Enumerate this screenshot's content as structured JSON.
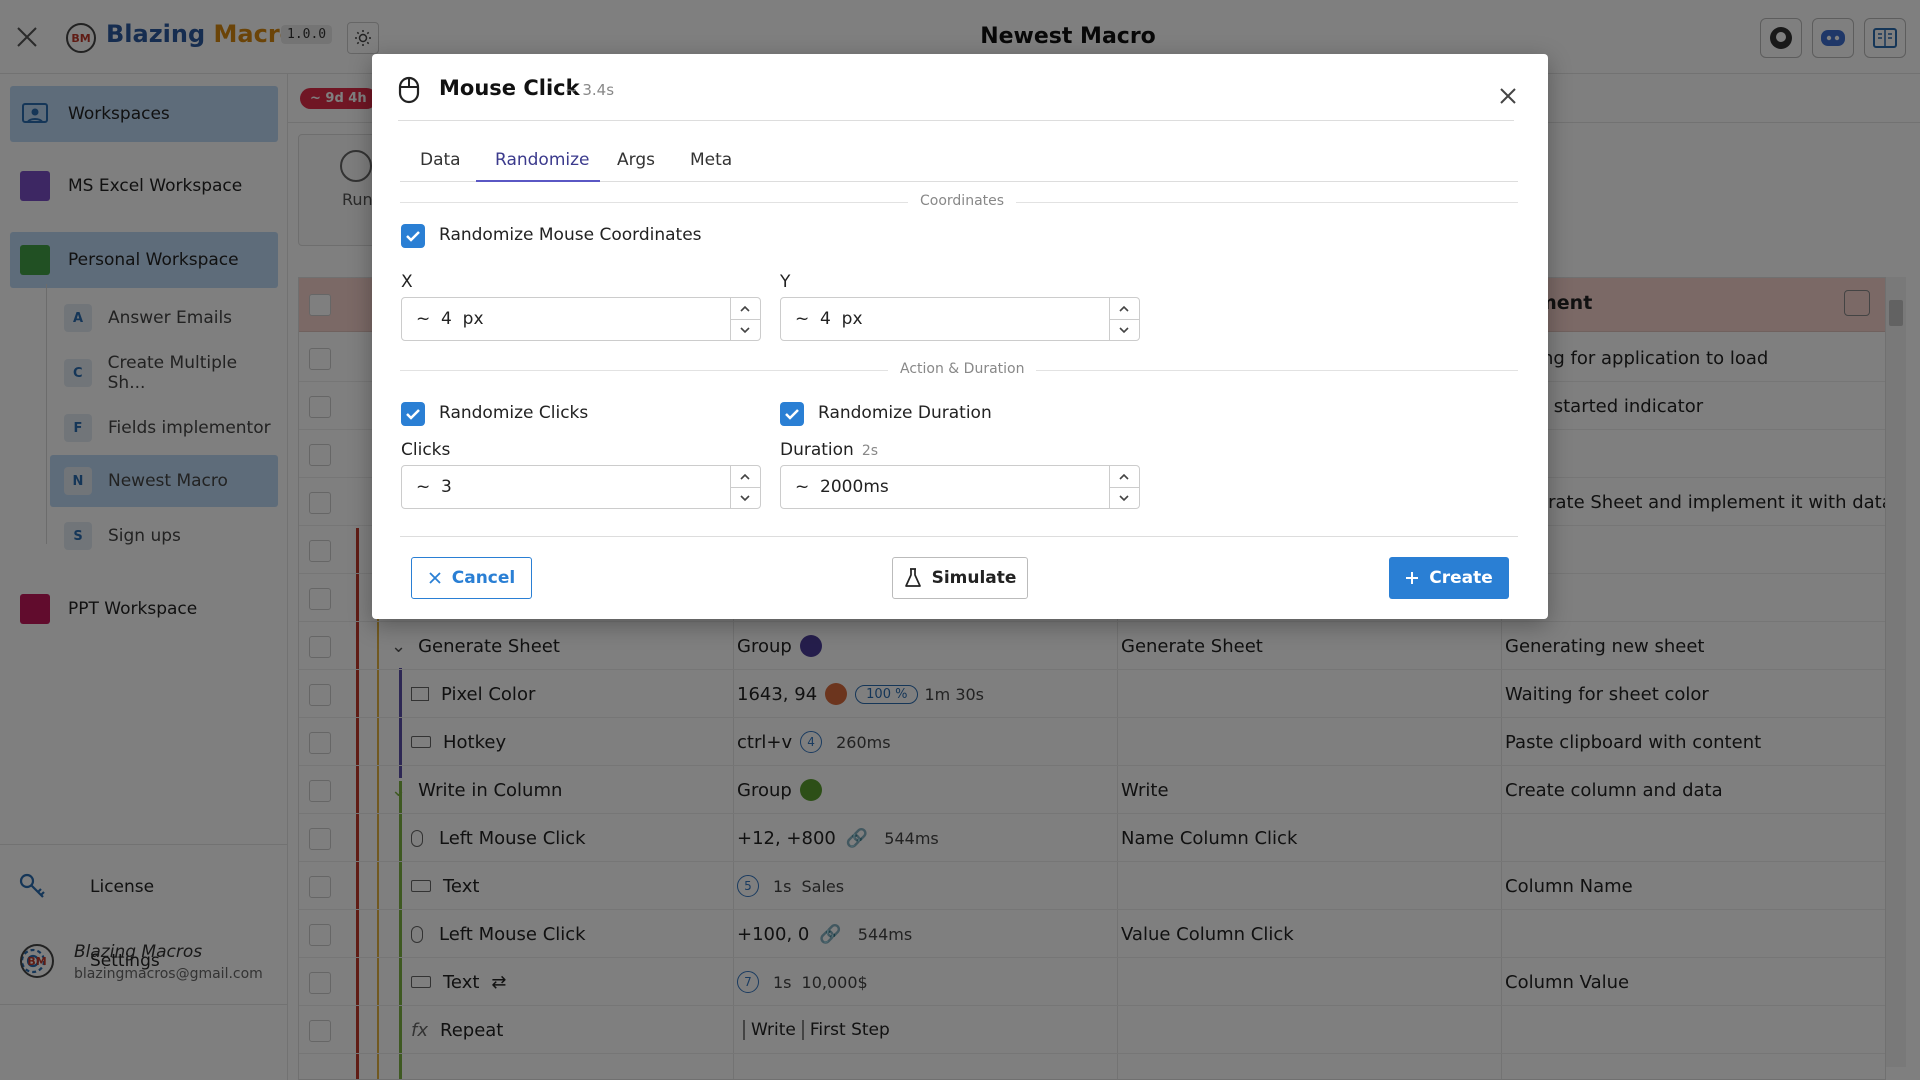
{
  "app": {
    "brand_part1": "Blazing",
    "brand_part2": " Macros",
    "version": "1.0.0",
    "window_title": "Newest Macro",
    "logo_text": "BM"
  },
  "sidebar": {
    "workspaces_label": "Workspaces",
    "items": [
      {
        "label": "MS Excel Workspace",
        "color": "#7b4fc7"
      },
      {
        "label": "Personal Workspace",
        "color": "#43a047"
      },
      {
        "label": "PPT Workspace",
        "color": "#c2185b"
      }
    ],
    "macros": [
      {
        "letter": "A",
        "label": "Answer Emails"
      },
      {
        "letter": "C",
        "label": "Create Multiple Sh..."
      },
      {
        "letter": "F",
        "label": "Fields implementor"
      },
      {
        "letter": "N",
        "label": "Newest Macro"
      },
      {
        "letter": "S",
        "label": "Sign ups"
      }
    ],
    "license_label": "License",
    "settings_label": "Settings",
    "user_name": "Blazing Macros",
    "user_email": "blazingmacros@gmail.com"
  },
  "main": {
    "time_badge": "~ 9d 4h",
    "run_label": "Run",
    "header_partial": "ment",
    "rows": [
      {
        "c4": "ing for application to load"
      },
      {
        "c4": "o started indicator"
      },
      {
        "c4": ""
      },
      {
        "c4": "erate Sheet and implement it with data"
      },
      {
        "name": "Generate Sheet",
        "type": "Group",
        "c3": "Generate Sheet",
        "c4": "Generating new sheet"
      },
      {
        "name": "Pixel Color",
        "value": "1643, 94",
        "pct": "100 %",
        "dur": "1m 30s",
        "c4": "Waiting for sheet color"
      },
      {
        "name": "Hotkey",
        "value": "ctrl+v",
        "n": "4",
        "dur": "260ms",
        "c4": "Paste clipboard with content"
      },
      {
        "name": "Write in Column",
        "type": "Group",
        "c3": "Write",
        "c4": "Create column and data"
      },
      {
        "name": "Left Mouse Click",
        "value": "+12, +800",
        "dur": "544ms",
        "c3": "Name Column Click"
      },
      {
        "name": "Text",
        "n": "5",
        "t": "1s",
        "extra": "Sales",
        "c4": "Column Name"
      },
      {
        "name": "Left Mouse Click",
        "value": "+100, 0",
        "dur": "544ms",
        "c3": "Value Column Click"
      },
      {
        "name": "Text",
        "n": "7",
        "t": "1s",
        "extra": "10,000$",
        "c4": "Column Value"
      },
      {
        "name": "Repeat",
        "tag1": "Write",
        "tag2": "First Step"
      }
    ]
  },
  "modal": {
    "title": "Mouse Click",
    "subtitle": "~ 3.4s",
    "tabs": [
      "Data",
      "Randomize",
      "Args",
      "Meta"
    ],
    "active_tab": "Randomize",
    "section_coordinates": "Coordinates",
    "randomize_coords_label": "Randomize Mouse Coordinates",
    "x_label": "X",
    "x_value": "~  4  px",
    "y_label": "Y",
    "y_value": "~  4  px",
    "section_action": "Action & Duration",
    "randomize_clicks_label": "Randomize Clicks",
    "randomize_duration_label": "Randomize Duration",
    "clicks_label": "Clicks",
    "clicks_value": "~  3",
    "duration_label": "Duration",
    "duration_hint": "2s",
    "duration_value": "~  2000ms",
    "cancel_label": "Cancel",
    "simulate_label": "Simulate",
    "create_label": "Create"
  },
  "colors": {
    "accent": "#2a7fd4",
    "tab_active": "#5a57c4",
    "badge_red": "#e02d49"
  }
}
